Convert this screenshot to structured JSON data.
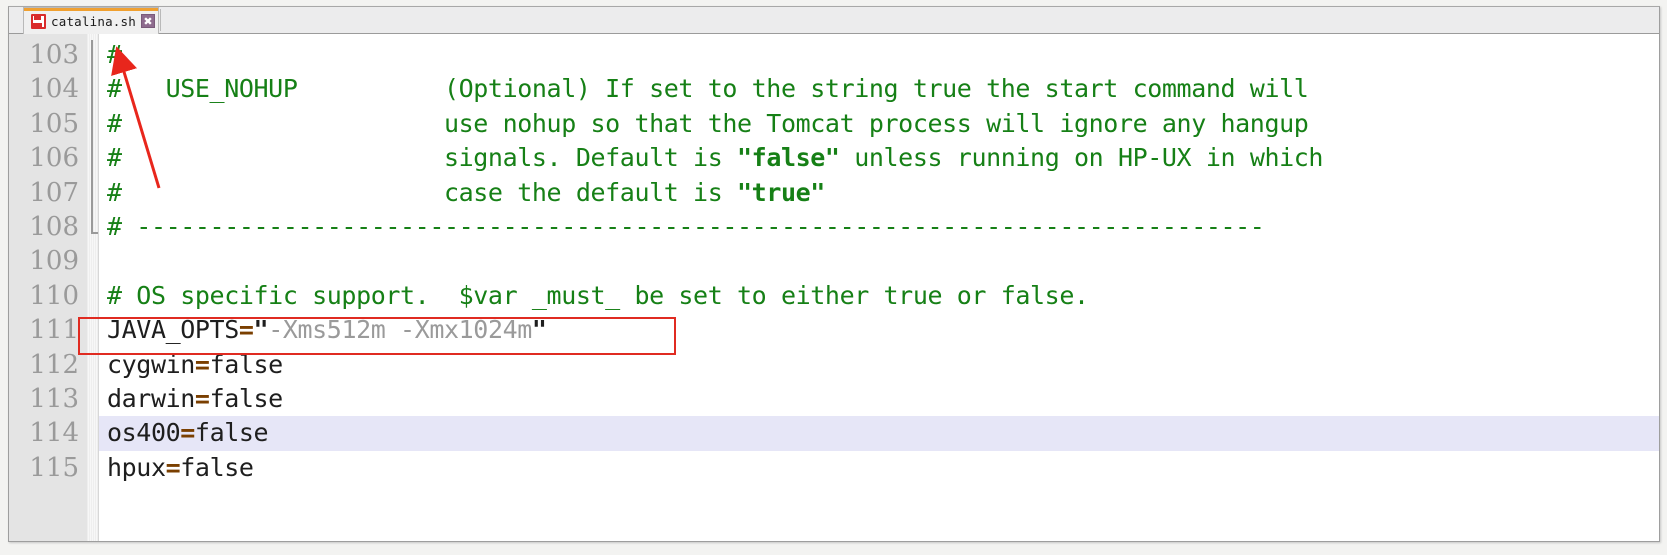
{
  "window": {
    "title": "catalina.sh"
  },
  "tab": {
    "label": "catalina.sh",
    "save_icon": "floppy-disk-icon",
    "close_icon": "close-icon",
    "close_glyph": "✖",
    "accent_color": "#f0a030"
  },
  "colors": {
    "comment": "#168016",
    "operator": "#7a3f00",
    "string": "#9a9a9a",
    "plain": "#1e1e1e",
    "current_line": "#e6e6f7",
    "gutter_bg": "#e4e4e4",
    "gutter_text": "#9a9a9a",
    "annotation": "#e02b21"
  },
  "editor": {
    "language": "shell",
    "first_visible_line": 103,
    "last_visible_line": 115,
    "current_line": 114,
    "fold_region": "103-108",
    "gutter_numbers": [
      "103",
      "104",
      "105",
      "106",
      "107",
      "108",
      "109",
      "110",
      "111",
      "112",
      "113",
      "114",
      "115"
    ],
    "lines": [
      {
        "number": "103",
        "segments": [
          {
            "cls": "cmt",
            "text": "#"
          }
        ]
      },
      {
        "number": "104",
        "segments": [
          {
            "cls": "cmt",
            "text": "#   USE_NOHUP          (Optional) If set to the string true the start command will"
          }
        ]
      },
      {
        "number": "105",
        "segments": [
          {
            "cls": "cmt",
            "text": "#                      use nohup so that the Tomcat process will ignore any hangup"
          }
        ]
      },
      {
        "number": "106",
        "segments": [
          {
            "cls": "cmt",
            "text": "#                      signals. Default is "
          },
          {
            "cls": "cmtq",
            "text": "\"false\""
          },
          {
            "cls": "cmt",
            "text": " unless running on HP-UX in which"
          }
        ]
      },
      {
        "number": "107",
        "segments": [
          {
            "cls": "cmt",
            "text": "#                      case the default is "
          },
          {
            "cls": "cmtq",
            "text": "\"true\""
          }
        ]
      },
      {
        "number": "108",
        "segments": [
          {
            "cls": "cmt",
            "text": "# -----------------------------------------------------------------------------"
          }
        ]
      },
      {
        "number": "109",
        "segments": [
          {
            "cls": "plain",
            "text": ""
          }
        ]
      },
      {
        "number": "110",
        "segments": [
          {
            "cls": "cmt",
            "text": "# OS specific support.  $var _must_ be set to either true or false."
          }
        ]
      },
      {
        "number": "111",
        "segments": [
          {
            "cls": "plain",
            "text": "JAVA_OPTS"
          },
          {
            "cls": "op",
            "text": "="
          },
          {
            "cls": "strq",
            "text": "\""
          },
          {
            "cls": "str",
            "text": "-Xms512m -Xmx1024m"
          },
          {
            "cls": "strq",
            "text": "\""
          }
        ]
      },
      {
        "number": "112",
        "segments": [
          {
            "cls": "plain",
            "text": "cygwin"
          },
          {
            "cls": "op",
            "text": "="
          },
          {
            "cls": "plain",
            "text": "false"
          }
        ]
      },
      {
        "number": "113",
        "segments": [
          {
            "cls": "plain",
            "text": "darwin"
          },
          {
            "cls": "op",
            "text": "="
          },
          {
            "cls": "plain",
            "text": "false"
          }
        ]
      },
      {
        "number": "114",
        "current": true,
        "segments": [
          {
            "cls": "plain",
            "text": "os400"
          },
          {
            "cls": "op",
            "text": "="
          },
          {
            "cls": "plain",
            "text": "false"
          }
        ]
      },
      {
        "number": "115",
        "segments": [
          {
            "cls": "plain",
            "text": "hpux"
          },
          {
            "cls": "op",
            "text": "="
          },
          {
            "cls": "plain",
            "text": "false"
          }
        ]
      }
    ]
  },
  "annotations": {
    "highlight_rect": {
      "name": "java-opts-highlight-rect",
      "targets_line": "111",
      "color": "#e02b21"
    },
    "arrow": {
      "name": "red-arrow-annotation",
      "points_to_line": "103",
      "color": "#e02b21"
    }
  }
}
